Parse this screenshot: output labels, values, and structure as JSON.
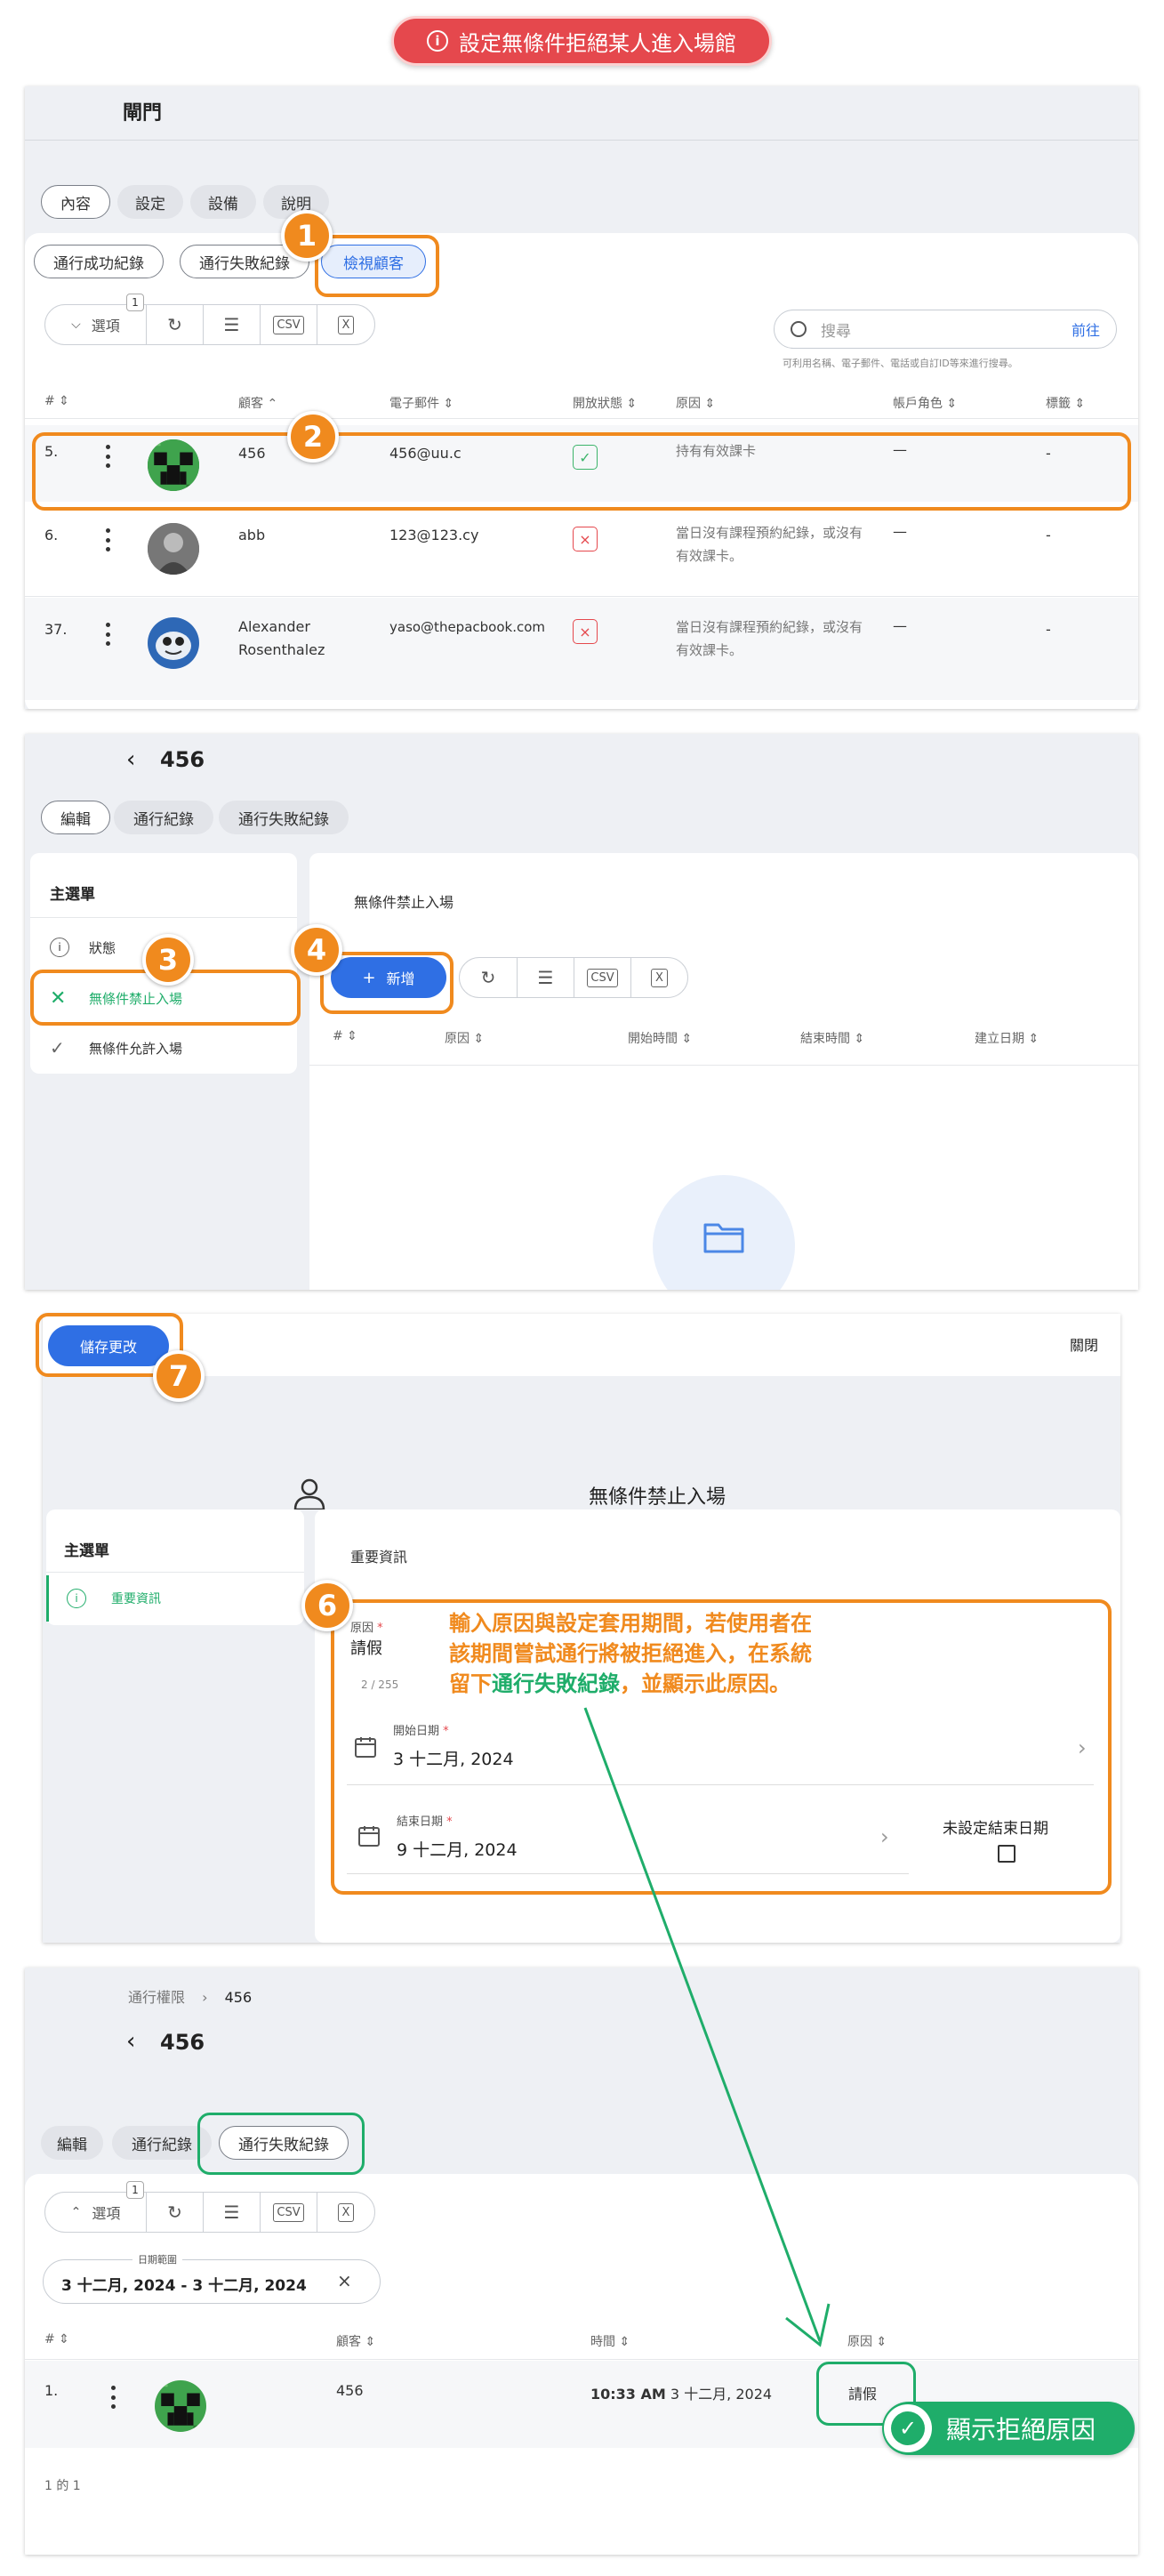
{
  "title_banner": "設定無條件拒絕某人進入場館",
  "s1": {
    "page_title": "閘門",
    "tabs": [
      "內容",
      "設定",
      "設備",
      "說明"
    ],
    "subtabs": [
      "通行成功紀錄",
      "通行失敗紀錄",
      "檢視顧客"
    ],
    "options_label": "選項",
    "options_badge": "1",
    "search_placeholder": "搜尋",
    "search_go": "前往",
    "search_hint": "可利用名稱、電子郵件、電話或自訂ID等來進行搜尋。",
    "headers": [
      "#",
      "顧客",
      "電子郵件",
      "開放狀態",
      "原因",
      "帳戶角色",
      "標籤"
    ],
    "rows": [
      {
        "num": "5.",
        "name": "456",
        "email": "456@uu.c",
        "reason": "持有有效課卡",
        "role": "—",
        "tag": "-",
        "status": "ok"
      },
      {
        "num": "6.",
        "name": "abb",
        "email": "123@123.cy",
        "reason": "當日沒有課程預約紀錄，或沒有有效課卡。",
        "role": "—",
        "tag": "-",
        "status": "no"
      },
      {
        "num": "37.",
        "name": "Alexander Rosenthalez",
        "email": "yaso@thepacbook.com",
        "reason": "當日沒有課程預約紀錄，或沒有有效課卡。",
        "role": "—",
        "tag": "-",
        "status": "no"
      }
    ]
  },
  "s2": {
    "title": "456",
    "tabs": [
      "編輯",
      "通行紀錄",
      "通行失敗紀錄"
    ],
    "menu_title": "主選單",
    "menu": [
      "狀態",
      "無條件禁止入場",
      "無條件允許入場"
    ],
    "content_title": "無條件禁止入場",
    "add": "新增",
    "headers": [
      "#",
      "原因",
      "開始時間",
      "結束時間",
      "建立日期"
    ]
  },
  "s3": {
    "save": "儲存更改",
    "close": "關閉",
    "title": "無條件禁止入場",
    "menu_title": "主選單",
    "menu_item": "重要資訊",
    "section": "重要資訊",
    "reason_label": "原因",
    "reason_value": "請假",
    "reason_count": "2 / 255",
    "start_label": "開始日期",
    "start_value": "3 十二月, 2024",
    "end_label": "結束日期",
    "end_value": "9 十二月, 2024",
    "no_end": "未設定結束日期",
    "note_l1": "輸入原因與設定套用期間，若使用者在",
    "note_l2": "該期間嘗試通行將被拒絕進入，在系統",
    "note_l3a": "留下",
    "note_l3b": "通行失敗紀錄",
    "note_l3c": "，並顯示此原因。"
  },
  "s4": {
    "breadcrumb": [
      "通行權限",
      "456"
    ],
    "title": "456",
    "tabs": [
      "編輯",
      "通行紀錄",
      "通行失敗紀錄"
    ],
    "options_label": "選項",
    "options_badge": "1",
    "date_range_label": "日期範圍",
    "date_range": "3 十二月, 2024 - 3 十二月, 2024",
    "headers": [
      "#",
      "顧客",
      "時間",
      "原因"
    ],
    "row": {
      "num": "1.",
      "name": "456",
      "time_b": "10:33 AM",
      "time_r": "3 十二月, 2024",
      "reason": "請假"
    },
    "pagination": "1 的 1",
    "callout": "顯示拒絕原因"
  },
  "colors": {
    "orange": "#f08a1e",
    "green": "#1fad6a",
    "blue": "#2f6fe4",
    "red": "#e5484d"
  }
}
